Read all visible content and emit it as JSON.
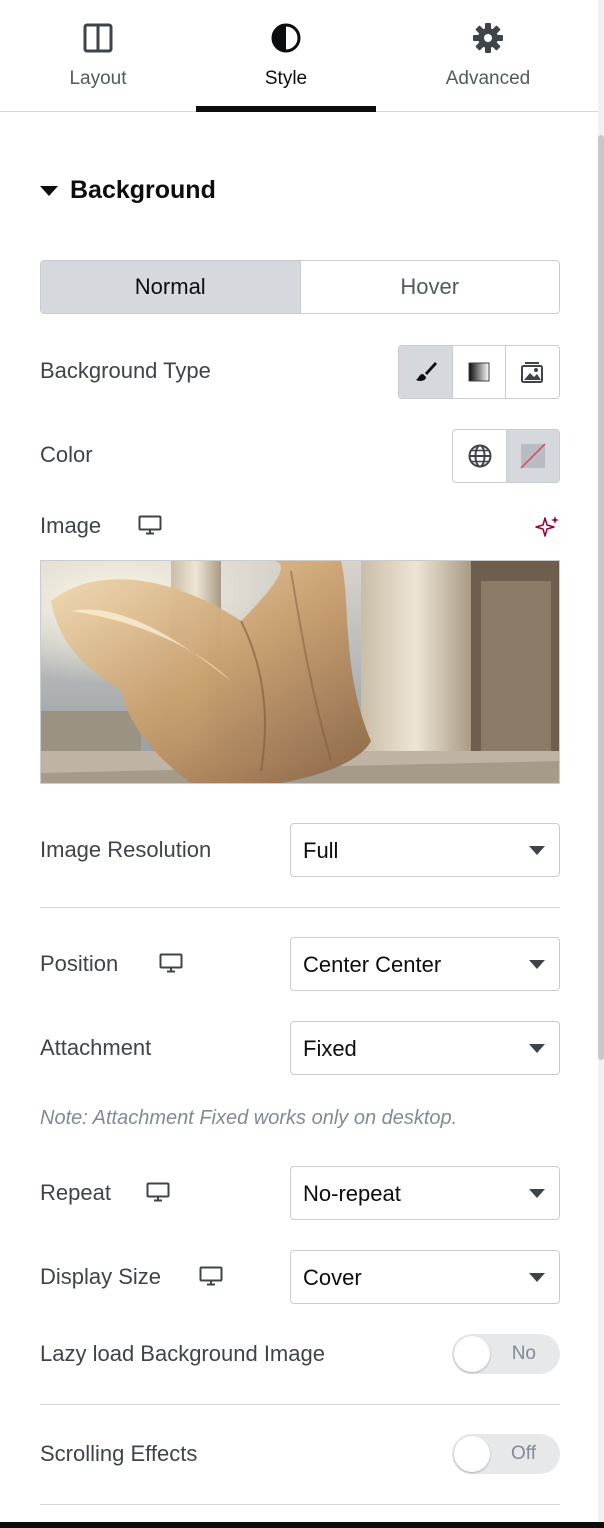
{
  "tabs": [
    {
      "label": "Layout",
      "icon": "layout-icon"
    },
    {
      "label": "Style",
      "icon": "half-circle-icon",
      "active": true
    },
    {
      "label": "Advanced",
      "icon": "gear-icon"
    }
  ],
  "section": {
    "title": "Background",
    "expanded": true
  },
  "state_switch": {
    "normal": "Normal",
    "hover": "Hover",
    "active": "Normal"
  },
  "background_type": {
    "label": "Background Type",
    "options": [
      "brush-icon",
      "gradient-icon",
      "slideshow-icon"
    ],
    "active": "brush-icon"
  },
  "color": {
    "label": "Color",
    "icons": [
      "globe-icon",
      "no-color-swatch-icon"
    ]
  },
  "image": {
    "label": "Image",
    "responsive_icon": "monitor-icon",
    "ai_icon": "sparkle-icon"
  },
  "image_resolution": {
    "label": "Image Resolution",
    "value": "Full"
  },
  "position": {
    "label": "Position",
    "value": "Center Center"
  },
  "attachment": {
    "label": "Attachment",
    "value": "Fixed"
  },
  "note": "Note: Attachment Fixed works only on desktop.",
  "repeat": {
    "label": "Repeat",
    "value": "No-repeat"
  },
  "display_size": {
    "label": "Display Size",
    "value": "Cover"
  },
  "lazy_load": {
    "label": "Lazy load Background Image",
    "value": "No"
  },
  "scrolling_effects": {
    "label": "Scrolling Effects",
    "value": "Off"
  },
  "colors": {
    "accent_dark": "#0c0d0e",
    "border": "#c9ccd1",
    "active_bg": "#d5d8dc",
    "ai_purple": "#93003c"
  }
}
